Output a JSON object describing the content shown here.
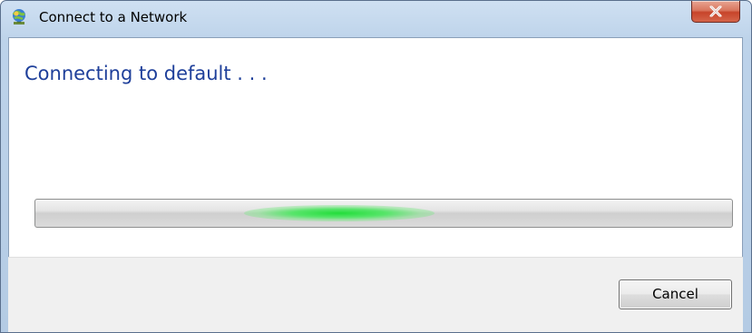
{
  "window": {
    "title": "Connect to a Network",
    "icon": "network-connect-icon",
    "close_icon": "close-icon"
  },
  "main": {
    "heading": "Connecting to default . . ."
  },
  "progress": {
    "state": "indeterminate",
    "accent_color": "#22dd3a"
  },
  "footer": {
    "cancel_label": "Cancel"
  },
  "colors": {
    "heading": "#1e3f9a",
    "close_button": "#c7442a"
  }
}
